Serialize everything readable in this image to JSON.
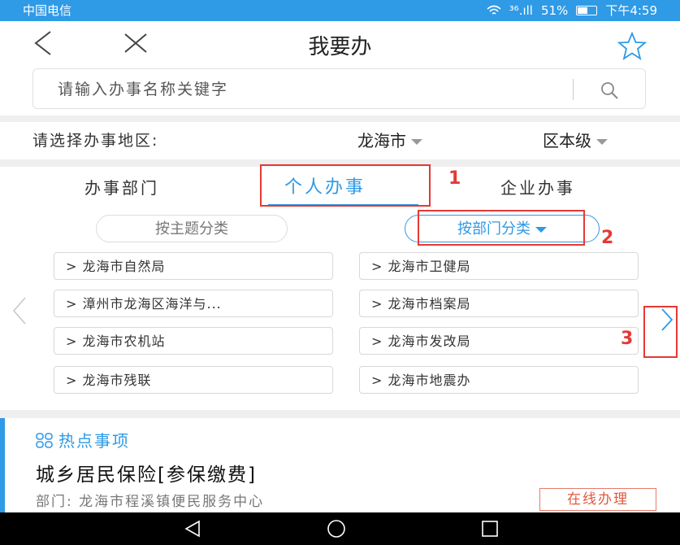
{
  "status_bar": {
    "carrier": "中国电信",
    "signal": "³⁶.ıll",
    "battery": "51%",
    "time": "下午4:59"
  },
  "nav": {
    "back_icon": "chevron-left-icon",
    "close_icon": "close-icon",
    "title": "我要办",
    "favorite_icon": "star-outline-icon"
  },
  "search": {
    "placeholder": "请输入办事名称关键字",
    "icon": "search-icon"
  },
  "region": {
    "label": "请选择办事地区:",
    "city": "龙海市",
    "level": "区本级"
  },
  "tabs": [
    {
      "label": "办事部门"
    },
    {
      "label": "个人办事",
      "active": true
    },
    {
      "label": "企业办事"
    }
  ],
  "filters": {
    "by_topic": "按主题分类",
    "by_department": "按部门分类"
  },
  "departments": [
    "> 龙海市自然局",
    "> 龙海市卫健局",
    "> 漳州市龙海区海洋与...",
    "> 龙海市档案局",
    "> 龙海市农机站",
    "> 龙海市发改局",
    "> 龙海市残联",
    "> 龙海市地震办"
  ],
  "annotations": [
    "1",
    "2",
    "3"
  ],
  "hot": {
    "header": "热点事项",
    "item_title": "城乡居民保险[参保缴费]",
    "department": "部门: 龙海市程溪镇便民服务中心",
    "action": "在线办理"
  },
  "colors": {
    "accent": "#2f9ae6",
    "annotation": "#e53935"
  }
}
